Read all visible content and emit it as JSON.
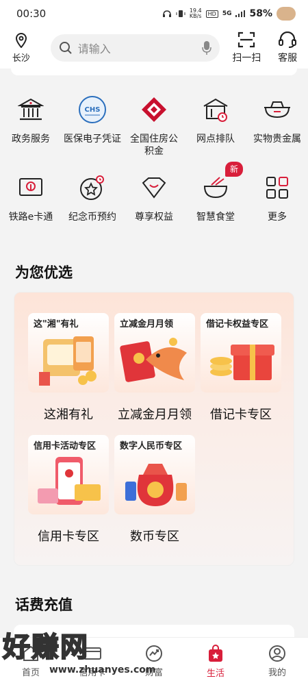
{
  "status": {
    "time": "00:30",
    "network_speed": "19.4",
    "network_unit": "KB/s",
    "hd": "HD",
    "signal": "5G",
    "battery": "58%"
  },
  "header": {
    "location": "长沙",
    "search_placeholder": "请输入",
    "scan_label": "扫一扫",
    "service_label": "客服"
  },
  "services": [
    [
      {
        "label": "政务服务",
        "icon": "government-icon"
      },
      {
        "label": "医保电子凭证",
        "icon": "chs-icon"
      },
      {
        "label": "全国住房公积金",
        "icon": "housing-fund-icon"
      },
      {
        "label": "网点排队",
        "icon": "branch-queue-icon"
      },
      {
        "label": "实物贵金属",
        "icon": "gold-ingot-icon"
      }
    ],
    [
      {
        "label": "铁路e卡通",
        "icon": "railway-icon"
      },
      {
        "label": "纪念币预约",
        "icon": "coin-icon"
      },
      {
        "label": "尊享权益",
        "icon": "diamond-icon"
      },
      {
        "label": "智慧食堂",
        "icon": "bowl-icon",
        "badge": "新"
      },
      {
        "label": "更多",
        "icon": "more-grid-icon"
      }
    ]
  ],
  "recommend": {
    "title": "为您优选",
    "items": [
      {
        "tag": "这\"湘\"有礼",
        "label": "这湘有礼"
      },
      {
        "tag": "立减金月月领",
        "label": "立减金月月领"
      },
      {
        "tag": "借记卡权益专区",
        "label": "借记卡专区"
      },
      {
        "tag": "信用卡活动专区",
        "label": "信用卡专区"
      },
      {
        "tag": "数字人民币专区",
        "label": "数币专区"
      }
    ]
  },
  "topup": {
    "title": "话费充值"
  },
  "nav": [
    {
      "label": "首页",
      "icon": "home-icon"
    },
    {
      "label": "信用卡",
      "icon": "credit-card-icon"
    },
    {
      "label": "财富",
      "icon": "wealth-icon"
    },
    {
      "label": "生活",
      "icon": "life-bag-icon",
      "active": true
    },
    {
      "label": "我的",
      "icon": "profile-icon"
    }
  ],
  "watermark": {
    "main": "好赚网",
    "url": "www.zhuanyes.com"
  },
  "colors": {
    "accent": "#d81e3a",
    "panel_bg": "#fde4d8"
  }
}
